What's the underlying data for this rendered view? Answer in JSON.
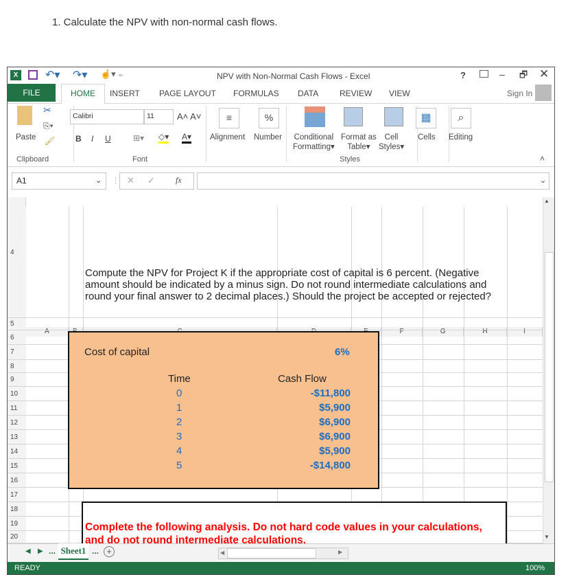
{
  "question": "1. Calculate the NPV with non-normal cash flows.",
  "window": {
    "title": "NPV with Non-Normal Cash Flows - Excel",
    "help": "?",
    "sign_in": "Sign In"
  },
  "tabs": [
    "FILE",
    "HOME",
    "INSERT",
    "PAGE LAYOUT",
    "FORMULAS",
    "DATA",
    "REVIEW",
    "VIEW"
  ],
  "ribbon": {
    "paste": "Paste",
    "font_name": "Calibri",
    "font_size": "11",
    "bold": "B",
    "italic": "I",
    "underline": "U",
    "alignment": "Alignment",
    "number": "Number",
    "percent": "%",
    "conditional": "Conditional",
    "formatting": "Formatting",
    "format_as": "Format as",
    "table": "Table",
    "cell": "Cell",
    "styles_btn": "Styles",
    "cells": "Cells",
    "editing": "Editing",
    "groups": {
      "clipboard": "Clipboard",
      "font": "Font",
      "styles": "Styles"
    }
  },
  "formula_bar": {
    "name_box": "A1",
    "fx": "fx",
    "value": ""
  },
  "columns": [
    "A",
    "B",
    "C",
    "D",
    "E",
    "F",
    "G",
    "H",
    "I"
  ],
  "rows": [
    "4",
    "5",
    "6",
    "7",
    "8",
    "9",
    "10",
    "11",
    "12",
    "13",
    "14",
    "15",
    "16",
    "17",
    "18",
    "19",
    "20"
  ],
  "sheet": {
    "prompt": "Compute the NPV for Project K if the appropriate cost of capital is 6 percent. (Negative amount should be indicated by a minus sign. Do not round intermediate calculations and round your final answer to 2 decimal places.) Should the project be accepted or rejected?",
    "cost_label": "Cost of capital",
    "cost_value": "6%",
    "time_header": "Time",
    "cf_header": "Cash Flow",
    "times": [
      "0",
      "1",
      "2",
      "3",
      "4",
      "5"
    ],
    "cash_flows": [
      "-$11,800",
      "$5,900",
      "$6,900",
      "$6,900",
      "$5,900",
      "-$14,800"
    ],
    "instruction": "Complete the following analysis. Do not hard code values in your calculations, and do not round intermediate calculations."
  },
  "sheet_tabs": {
    "ellipsis": "...",
    "active": "Sheet1"
  },
  "status": {
    "ready": "READY",
    "zoom": "100%"
  },
  "colors": {
    "excel_green": "#217346",
    "box_fill": "#f8bf8f",
    "value_blue": "#1f6ebf",
    "instruction_red": "#ff0000"
  }
}
